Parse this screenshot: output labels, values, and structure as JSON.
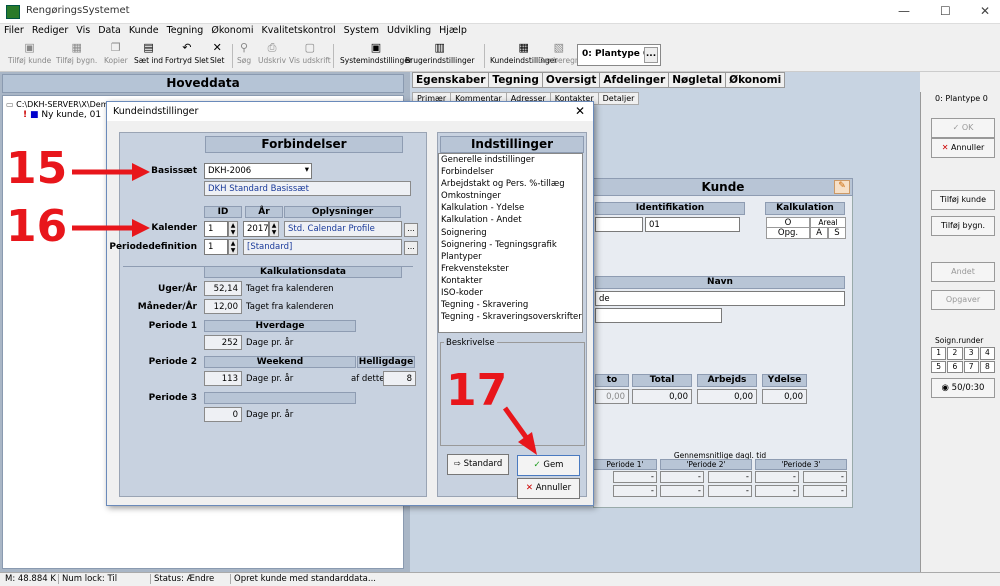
{
  "app": {
    "title": "RengøringsSystemet"
  },
  "menu": [
    "Filer",
    "Rediger",
    "Vis",
    "Data",
    "Kunde",
    "Tegning",
    "Økonomi",
    "Kvalitetskontrol",
    "System",
    "Udvikling",
    "Hjælp"
  ],
  "toolbar": {
    "tilfoj_kunde": "Tilføj kunde",
    "tilfoj_bygn": "Tilføj bygn.",
    "kopier": "Kopier",
    "saet_ind": "Sæt ind",
    "fortryd_slet": "Fortryd Slet",
    "slet": "Slet",
    "sog": "Søg",
    "udskriv": "Udskriv",
    "vis_udskrift": "Vis udskrift",
    "systemindstillinger": "Systemindstillinger",
    "brugerindstillinger": "Brugerindstillinger",
    "kundeindstillinger": "Kundeindstillinger",
    "genberegn": "Genberegn",
    "plantype": "0: Plantype 0",
    "plantype_btn": "..."
  },
  "left_panel": {
    "title": "Hoveddata",
    "tree_root": "C:\\DKH-SERVER\\X\\Demo-",
    "tree_child": "Ny kunde, 01"
  },
  "main_tabs": [
    "Egenskaber",
    "Tegning",
    "Oversigt",
    "Afdelinger",
    "Nøgletal",
    "Økonomi"
  ],
  "sub_tabs": [
    "Primær",
    "Kommentar",
    "Adresser",
    "Kontakter",
    "Detaljer"
  ],
  "kunde_panel": {
    "title": "Kunde",
    "identifikation": "Identifikation",
    "id_value": "01",
    "kalkulation": "Kalkulation",
    "o": "O",
    "areal_ber": "Areal ber.",
    "opg": "Opg.",
    "a": "A",
    "s": "S",
    "navn": "Navn",
    "navn_value": "de",
    "col_to": "to",
    "col_total": "Total",
    "col_arbejds": "Arbejds",
    "col_ydelse": "Ydelse",
    "val_to": "0,00",
    "val_total": "0,00",
    "val_arbejds": "0,00",
    "val_ydelse": "0,00",
    "gennemsnit": "Gennemsnitlige dagl. tid",
    "periode1": "Periode 1'",
    "periode2": "'Periode 2'",
    "periode3": "'Periode 3'",
    "dash": "-"
  },
  "side_panel": {
    "plantype": "0: Plantype 0",
    "ok": "OK",
    "annuller": "Annuller",
    "tilfoj_kunde": "Tilføj kunde",
    "tilfoj_bygn": "Tilføj bygn.",
    "andet": "Andet",
    "opgaver": "Opgaver",
    "soign_runder": "Soign.runder",
    "grid": [
      "1",
      "2",
      "3",
      "4",
      "5",
      "6",
      "7",
      "8"
    ],
    "counter": "50/0:30"
  },
  "dialog": {
    "title": "Kundeindstillinger",
    "forbindelser": "Forbindelser",
    "basissaet_label": "Basissæt",
    "basissaet_value": "DKH-2006",
    "basissaet_desc": "DKH Standard Basissæt",
    "col_id": "ID",
    "col_aar": "År",
    "col_oplysninger": "Oplysninger",
    "kalender_label": "Kalender",
    "kalender_id": "1",
    "kalender_aar": "2017",
    "kalender_info": "Std. Calendar Profile",
    "periodedef_label": "Periodedefinition",
    "periodedef_id": "1",
    "periodedef_info": "[Standard]",
    "dots": "...",
    "kalkulationsdata": "Kalkulationsdata",
    "uger_label": "Uger/År",
    "uger_value": "52,14",
    "uger_note": "Taget fra kalenderen",
    "maaneder_label": "Måneder/År",
    "maaneder_value": "12,00",
    "maaneder_note": "Taget fra kalenderen",
    "periode1_label": "Periode 1",
    "hverdage": "Hverdage",
    "hverdage_value": "252",
    "dage_pr_aar": "Dage pr. år",
    "periode2_label": "Periode 2",
    "weekend": "Weekend",
    "helligdage": "Helligdage",
    "weekend_value": "113",
    "af_dette": "af dette",
    "helligdage_value": "8",
    "periode3_label": "Periode 3",
    "periode3_value": "0",
    "indstillinger": "Indstillinger",
    "settings_list": [
      "Generelle indstillinger",
      "Forbindelser",
      "Arbejdstakt og Pers. %-tillæg",
      "Omkostninger",
      "Kalkulation - Ydelse",
      "Kalkulation - Andet",
      "Soignering",
      "Soignering - Tegningsgrafik",
      "Plantyper",
      "Frekvenstekster",
      "Kontakter",
      "ISO-koder",
      "Tegning - Skravering",
      "Tegning - Skraveringsoverskrifter"
    ],
    "beskrivelse": "Beskrivelse",
    "standard_btn": "Standard",
    "gem_btn": "Gem",
    "annuller_btn": "Annuller"
  },
  "annotations": {
    "n15": "15",
    "n16": "16",
    "n17": "17",
    "arrow_color": "#e8161b"
  },
  "statusbar": {
    "mem": "M: 48.884 K",
    "numlock": "Num lock: Til",
    "status": "Status: Ændre",
    "msg": "Opret kunde med standarddata..."
  }
}
